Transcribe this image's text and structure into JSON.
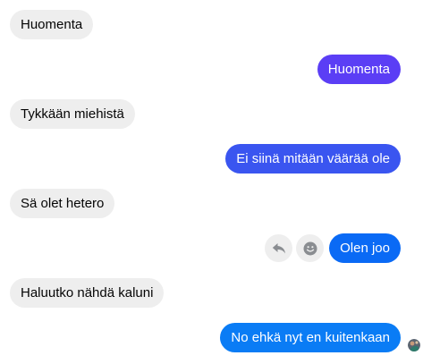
{
  "conversation": {
    "messages": [
      {
        "text": "Huomenta",
        "direction": "incoming"
      },
      {
        "text": "Huomenta",
        "direction": "outgoing",
        "color": "#5b3ef5"
      },
      {
        "text": "Tykkään miehistä",
        "direction": "incoming"
      },
      {
        "text": "Ei siinä mitään väärää ole",
        "direction": "outgoing",
        "color": "#3a55f0"
      },
      {
        "text": "Sä olet hetero",
        "direction": "incoming"
      },
      {
        "text": "Olen joo",
        "direction": "outgoing",
        "color": "#0a6af5"
      },
      {
        "text": "Haluutko nähdä kaluni",
        "direction": "incoming"
      },
      {
        "text": "No ehkä nyt en kuitenkaan",
        "direction": "outgoing",
        "color": "#0a7cf5"
      }
    ],
    "hover_actions": [
      "reply-icon",
      "react-icon"
    ],
    "colors": {
      "incoming_bg": "#eeeeee",
      "incoming_text": "#050505",
      "outgoing_text": "#ffffff"
    }
  }
}
